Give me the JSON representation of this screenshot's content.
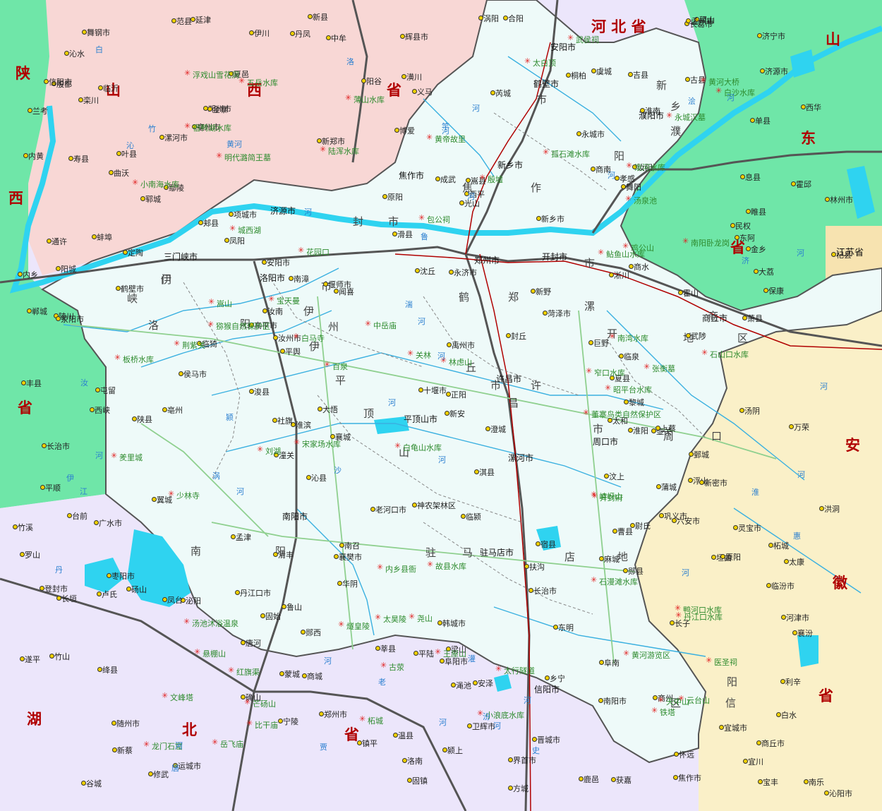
{
  "provinces": [
    {
      "name": "河北省",
      "chars": [
        "河",
        "北",
        "省"
      ],
      "kind": "inline"
    },
    {
      "name": "山西省",
      "chars": [
        "山",
        "西",
        "省"
      ],
      "kind": "spread"
    },
    {
      "name": "山东省",
      "chars": [
        "山",
        "东",
        "省"
      ],
      "kind": "spread"
    },
    {
      "name": "陕西省",
      "chars": [
        "陕",
        "西",
        "省"
      ],
      "kind": "spread"
    },
    {
      "name": "湖北省",
      "chars": [
        "湖",
        "北",
        "省"
      ],
      "kind": "spread"
    },
    {
      "name": "安徽省",
      "chars": [
        "安",
        "徽",
        "省"
      ],
      "kind": "spread"
    },
    {
      "name": "江苏省",
      "chars": [
        "江苏省"
      ],
      "kind": "box"
    }
  ],
  "cities": [
    "郑州市",
    "开封市",
    "洛阳市",
    "平顶山市",
    "安阳市",
    "鹤壁市",
    "新乡市",
    "焦作市",
    "濮阳市",
    "许昌市",
    "漯河市",
    "三门峡市",
    "南阳市",
    "商丘市",
    "信阳市",
    "周口市",
    "驻马店市",
    "济源市"
  ],
  "region_labels": [
    "门",
    "峡",
    "洛",
    "阳",
    "平",
    "顶",
    "山",
    "南",
    "阳",
    "驻",
    "马",
    "店",
    "地",
    "区",
    "信",
    "阳",
    "市",
    "周",
    "口",
    "地",
    "区",
    "商",
    "丘",
    "市",
    "许",
    "昌",
    "市",
    "漯",
    "开",
    "封",
    "市",
    "焦",
    "作",
    "新",
    "乡",
    "濮",
    "阳",
    "市",
    "鹤",
    "郑",
    "州",
    "市",
    "伊",
    "伊",
    "伊"
  ],
  "towns": [
    "古县",
    "屯留",
    "长子",
    "长治市",
    "壶关",
    "安泽",
    "洪洞",
    "临汾市",
    "浮山",
    "襄汾",
    "吉县",
    "乡宁",
    "侯马市",
    "河津市",
    "曲沃",
    "稷山",
    "翼城",
    "沁水",
    "万荣",
    "运城市",
    "夏县",
    "绛县",
    "闻喜",
    "垣曲",
    "临猗",
    "永济市",
    "芮城",
    "平陆",
    "陵川",
    "阳城",
    "高平市",
    "晋城市",
    "长治市",
    "沁县",
    "黎城",
    "平顺",
    "林州市",
    "殷都",
    "安阳市",
    "汤阴",
    "鹤壁市",
    "淇县",
    "浚县",
    "卫辉市",
    "辉县市",
    "获嘉",
    "新乡市",
    "原阳",
    "延津",
    "封丘",
    "长垣",
    "滑县",
    "内黄",
    "清丰",
    "南乐",
    "范县",
    "台前",
    "莘县",
    "阳谷",
    "东阿",
    "梁山",
    "汶上",
    "郓城",
    "鄄城",
    "菏泽市",
    "巨野",
    "济宁市",
    "东明",
    "定陶",
    "成武",
    "单县",
    "曹县",
    "金乡",
    "丰县",
    "砀山",
    "虞城",
    "夏邑",
    "永城市",
    "商丘市",
    "民权",
    "宁陵",
    "柘城",
    "睢县",
    "杞县",
    "兰考",
    "通许",
    "尉氏",
    "太康",
    "鹿邑",
    "郸城",
    "淮阳",
    "沈丘",
    "项城市",
    "商水",
    "西华",
    "扶沟",
    "鄢陵",
    "长葛市",
    "禹州市",
    "郏县",
    "宝丰",
    "叶县",
    "舞阳",
    "舞钢市",
    "方城",
    "南召",
    "鲁山",
    "汝州市",
    "汝阳",
    "嵩县",
    "伊川",
    "栾川",
    "卢氏",
    "灵宝市",
    "陕县",
    "渑池",
    "义马",
    "新安",
    "孟津",
    "偃师市",
    "巩义市",
    "登封市",
    "新密市",
    "荥阳市",
    "新郑市",
    "中牟",
    "郑州市",
    "原阳",
    "武陟",
    "温县",
    "孟州市",
    "沁阳市",
    "博爱",
    "修武",
    "焦作市",
    "济源市",
    "汝南",
    "确山",
    "泌阳",
    "遂平",
    "西平",
    "上蔡",
    "平舆",
    "正阳",
    "新蔡",
    "息县",
    "罗山",
    "光山",
    "潢川",
    "固始",
    "商城",
    "淮滨",
    "新县",
    "信阳市",
    "桐柏",
    "唐河",
    "社旗",
    "南阳市",
    "镇平",
    "内乡",
    "西峡",
    "淅川",
    "邓州市",
    "新野",
    "襄樊市",
    "枣阳市",
    "随州市",
    "广水市",
    "孝感",
    "大悟",
    "麻城",
    "老河口市",
    "丹江口市",
    "十堰市",
    "郧县",
    "郧西",
    "谷城",
    "保康",
    "南漳",
    "宜城市",
    "神农架林区",
    "竹山",
    "竹溪",
    "商南",
    "丹凤",
    "商州",
    "洛南",
    "华阴",
    "潼关",
    "大荔",
    "韩城市",
    "合阳",
    "澄城",
    "蒲城",
    "白水",
    "宜川",
    "临颍",
    "襄城",
    "漯河市",
    "临泉",
    "阜阳市",
    "界首市",
    "太和",
    "亳州市",
    "利辛",
    "蒙城",
    "颍上",
    "阜南",
    "霍邱",
    "六安市",
    "霍山",
    "金寨",
    "寿县",
    "凤台",
    "淮南",
    "蚌埠",
    "亳州",
    "固镇",
    "涡阳",
    "凤阳",
    "怀远",
    "萧县",
    "宿县",
    "临沂"
  ],
  "scenic_spots": [
    "太行隧道",
    "红旗渠",
    "林虑山",
    "殷墟",
    "羑里城",
    "文峰塔",
    "小南海水库",
    "岳飞庙",
    "云台山",
    "百泉",
    "明代潞简王墓",
    "比干庙",
    "猕猴自然保护区",
    "王屋山",
    "小浪底水库",
    "黄河游览区",
    "白马寺",
    "龙门石窟",
    "关林",
    "嵩山",
    "少林寺",
    "中岳庙",
    "浮戏山雪花洞",
    "黄帝故里",
    "白沙水库",
    "汤池沐浴温泉",
    "陆浑水库",
    "故县水库",
    "窄口水库",
    "尧山",
    "白龟山水库",
    "昭平台水库",
    "孤石滩水库",
    "石漫滩水库",
    "嵖岈山",
    "板桥水库",
    "宋家场水库",
    "薄山水库",
    "宿鸭湖水库",
    "南湾水库",
    "石山口水库",
    "五岳水库",
    "泼河水库",
    "鲇鱼山水库",
    "鸡公山",
    "董寨鸟类自然保护区",
    "汤泉池",
    "南阳卧龙岗",
    "武侯祠",
    "医圣祠",
    "张衡墓",
    "内乡县衙",
    "丹江口水库",
    "宝天曼",
    "荆紫关",
    "太白顶",
    "刘湖",
    "鸭河口水库",
    "花园口",
    "古荥",
    "黄河大桥",
    "开封府",
    "铁塔",
    "包公祠",
    "芒砀山",
    "燧皇陵",
    "永城汉墓",
    "太昊陵",
    "城西湖",
    "天中山",
    "悬棚山",
    "柘城"
  ],
  "rivers": [
    "黄河",
    "河",
    "河",
    "河",
    "汾",
    "河",
    "沁",
    "河",
    "洛",
    "河",
    "伊",
    "河",
    "汝",
    "河",
    "沙",
    "河",
    "颍",
    "河",
    "涡",
    "河",
    "淮",
    "河",
    "白",
    "河",
    "唐",
    "河",
    "丹",
    "江",
    "湍",
    "河",
    "老",
    "灌",
    "河",
    "史",
    "河",
    "竹",
    "竿",
    "河",
    "浍",
    "河",
    "惠",
    "济",
    "河",
    "贾",
    "鲁",
    "河"
  ],
  "colors": {
    "henan": "#eefaf9",
    "shanxi": "#f8d7d5",
    "hebei": "#ece6fb",
    "shandong": "#6fe6a8",
    "shaanxi": "#6fe6a8",
    "hubei": "#ece6fb",
    "anhui": "#faf0c8",
    "jiangsu": "#f7e3b0",
    "river": "#2fd3f0",
    "province_label": "#b00000",
    "rail": "#555555",
    "highway": "#b00000",
    "road": "#8fd08f"
  }
}
